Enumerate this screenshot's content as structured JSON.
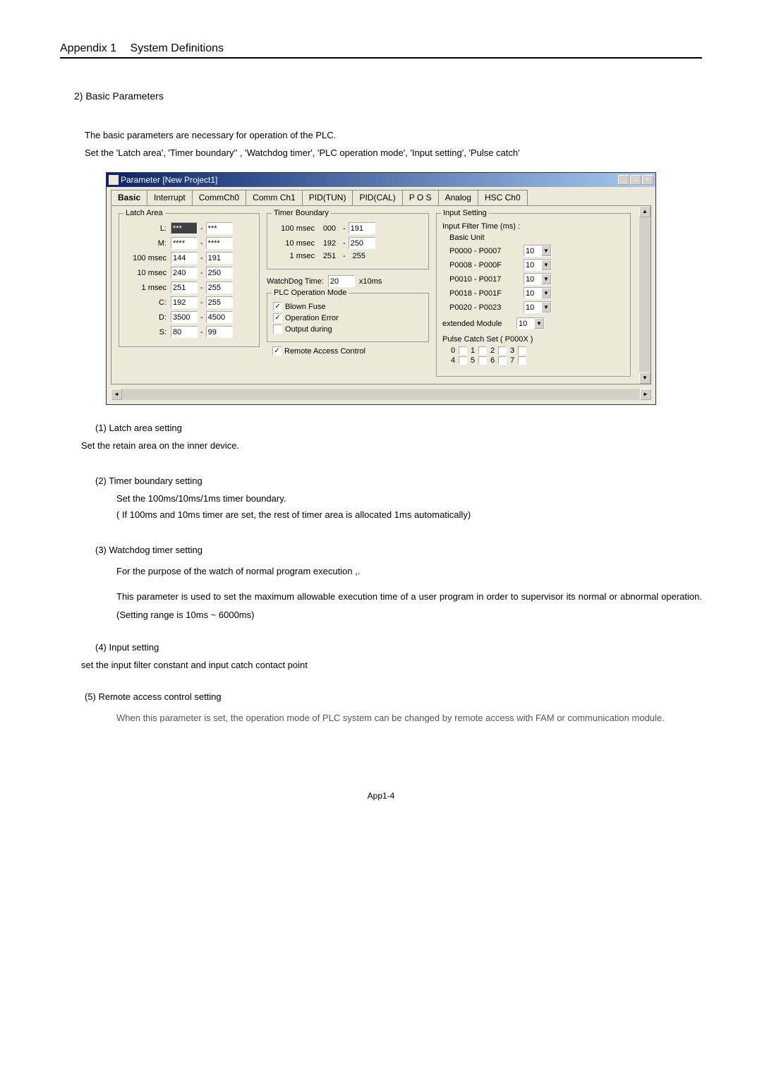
{
  "page": {
    "header_appendix": "Appendix 1",
    "header_title": "System Definitions",
    "section_number": "2)",
    "section_title": "Basic  Parameters",
    "intro1": "The basic parameters are necessary for operation of the PLC.",
    "intro2": "Set the 'Latch area', 'Timer boundary'' , 'Watchdog timer', 'PLC operation mode', 'Input setting', 'Pulse catch'",
    "footer": "App1-4"
  },
  "dialog": {
    "title": "Parameter [New Project1]",
    "tabs": [
      "Basic",
      "Interrupt",
      "CommCh0",
      "Comm Ch1",
      "PID(TUN)",
      "PID(CAL)",
      "P O S",
      "Analog",
      "HSC Ch0"
    ],
    "latch": {
      "title": "Latch Area",
      "rows": [
        {
          "label": "L:",
          "from": "***",
          "to": "***",
          "dark": true
        },
        {
          "label": "M:",
          "from": "****",
          "to": "****"
        },
        {
          "label": "100 msec",
          "from": "144",
          "to": "191"
        },
        {
          "label": "10 msec",
          "from": "240",
          "to": "250"
        },
        {
          "label": "1 msec",
          "from": "251",
          "to": "255"
        },
        {
          "label": "C:",
          "from": "192",
          "to": "255"
        },
        {
          "label": "D:",
          "from": "3500",
          "to": "4500"
        },
        {
          "label": "S:",
          "from": "80",
          "to": "99"
        }
      ]
    },
    "timer": {
      "title": "Timer Boundary",
      "rows": [
        {
          "label": "100 msec",
          "from": "000",
          "to": "191",
          "to_input": true
        },
        {
          "label": "10 msec",
          "from": "192",
          "to": "250",
          "to_input": true
        },
        {
          "label": "1 msec",
          "from": "251",
          "to": "255",
          "to_input": false
        }
      ]
    },
    "watchdog": {
      "label": "WatchDog Time:",
      "value": "20",
      "unit": "x10ms"
    },
    "plc_mode": {
      "title": "PLC Operation Mode",
      "items": [
        {
          "label": "Blown Fuse",
          "checked": true
        },
        {
          "label": "Operation Error",
          "checked": true
        },
        {
          "label": "Output during",
          "checked": false
        }
      ]
    },
    "remote": {
      "label": "Remote Access Control",
      "checked": true
    },
    "input_setting": {
      "title": "Input Setting",
      "filter_label": "Input Filter Time (ms) :",
      "basic_unit": "Basic Unit",
      "rows": [
        {
          "label": "P0000 - P0007",
          "val": "10"
        },
        {
          "label": "P0008 - P000F",
          "val": "10"
        },
        {
          "label": "P0010 - P0017",
          "val": "10"
        },
        {
          "label": "P0018 - P001F",
          "val": "10"
        },
        {
          "label": "P0020 - P0023",
          "val": "10"
        }
      ],
      "ext_label": "extended Module",
      "ext_val": "10",
      "pulse_label": "Pulse Catch Set ( P000X )",
      "pulse": [
        "0",
        "1",
        "2",
        "3",
        "4",
        "5",
        "6",
        "7"
      ]
    }
  },
  "explain": {
    "h1": "(1) Latch area setting",
    "p1": "Set the retain area on the inner device.",
    "h2": "(2) Timer boundary setting",
    "p2a": "Set the 100ms/10ms/1ms timer boundary.",
    "p2b": "( If 100ms and 10ms timer are set, the rest of timer area is allocated 1ms automatically)",
    "h3": "(3) Watchdog timer setting",
    "p3a": "For the purpose of the watch of normal program execution ,.",
    "p3b": "This parameter is used to set the maximum allowable execution time of a user program in order to supervisor its normal or abnormal operation. (Setting range is 10ms ~ 6000ms)",
    "h4": "(4) Input setting",
    "p4": "set the input filter constant and input catch contact point",
    "h5": "(5) Remote access control setting",
    "p5": "When this parameter is set, the operation mode of PLC system can be changed by remote access with FAM or communication module."
  }
}
